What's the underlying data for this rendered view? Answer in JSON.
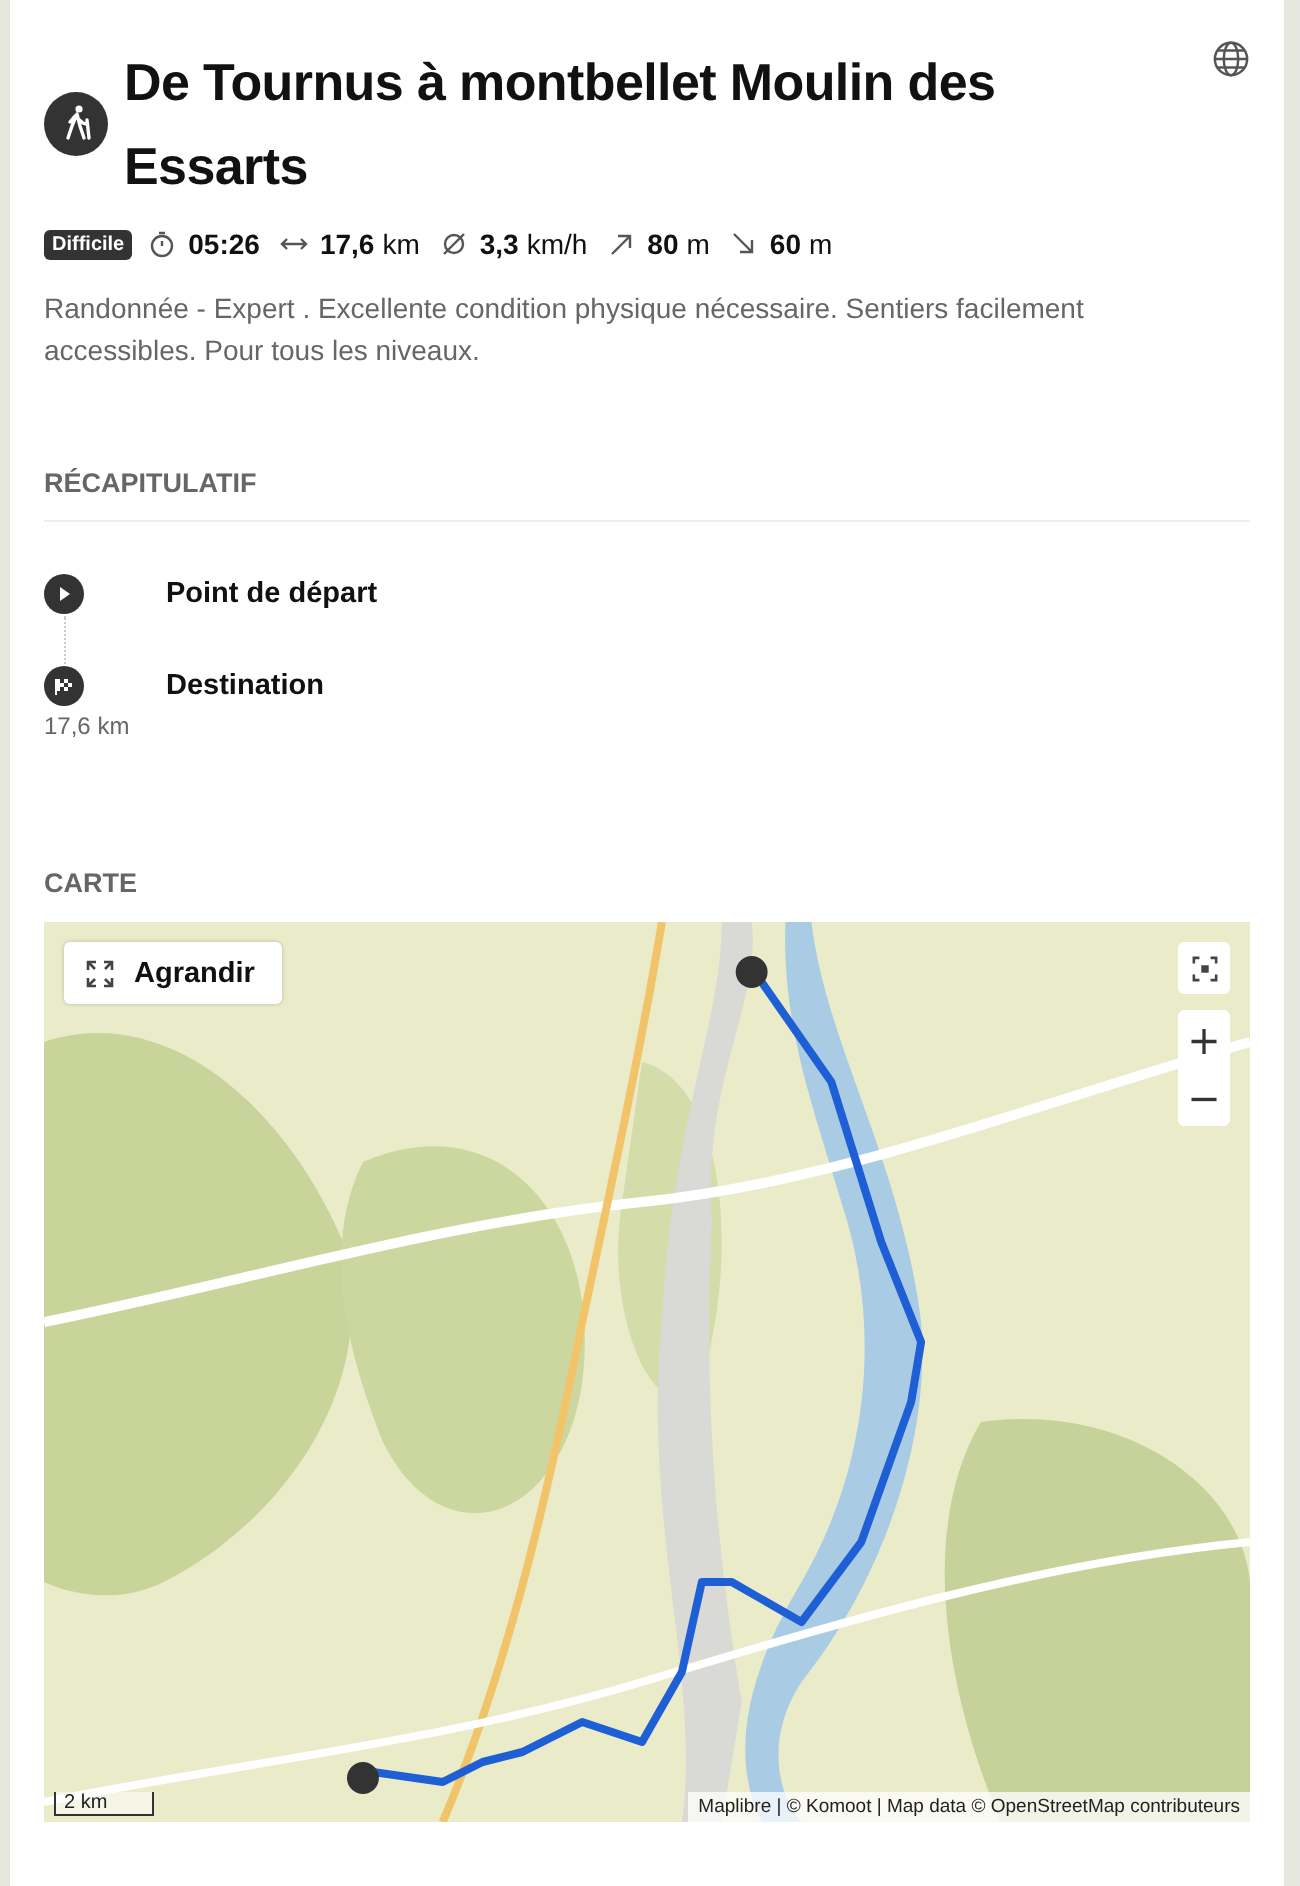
{
  "tour": {
    "title": "De Tournus à montbellet Moulin des Essarts",
    "difficulty": "Difficile",
    "stats": [
      {
        "kind": "duration",
        "value": "05:26"
      },
      {
        "kind": "distance",
        "value": "17,6",
        "unit": "km"
      },
      {
        "kind": "speed",
        "value": "3,3",
        "unit": "km/h"
      },
      {
        "kind": "ascent",
        "value": "80",
        "unit": "m"
      },
      {
        "kind": "descent",
        "value": "60",
        "unit": "m"
      }
    ],
    "description": "Randonnée - Expert . Excellente condition physique nécessaire. Sentiers facilement accessibles. Pour tous les niveaux."
  },
  "summary": {
    "heading": "RÉCAPITULATIF",
    "waypoints": [
      {
        "kind": "start",
        "label": "Point de départ"
      },
      {
        "kind": "end",
        "label": "Destination",
        "distance": "17,6 km"
      }
    ]
  },
  "map": {
    "heading": "CARTE",
    "expand_button": "Agrandir",
    "zoom_in": "+",
    "zoom_out": "−",
    "scale": "2 km",
    "attribution": "Maplibre | © Komoot | Map data © OpenStreetMap contributeurs"
  }
}
